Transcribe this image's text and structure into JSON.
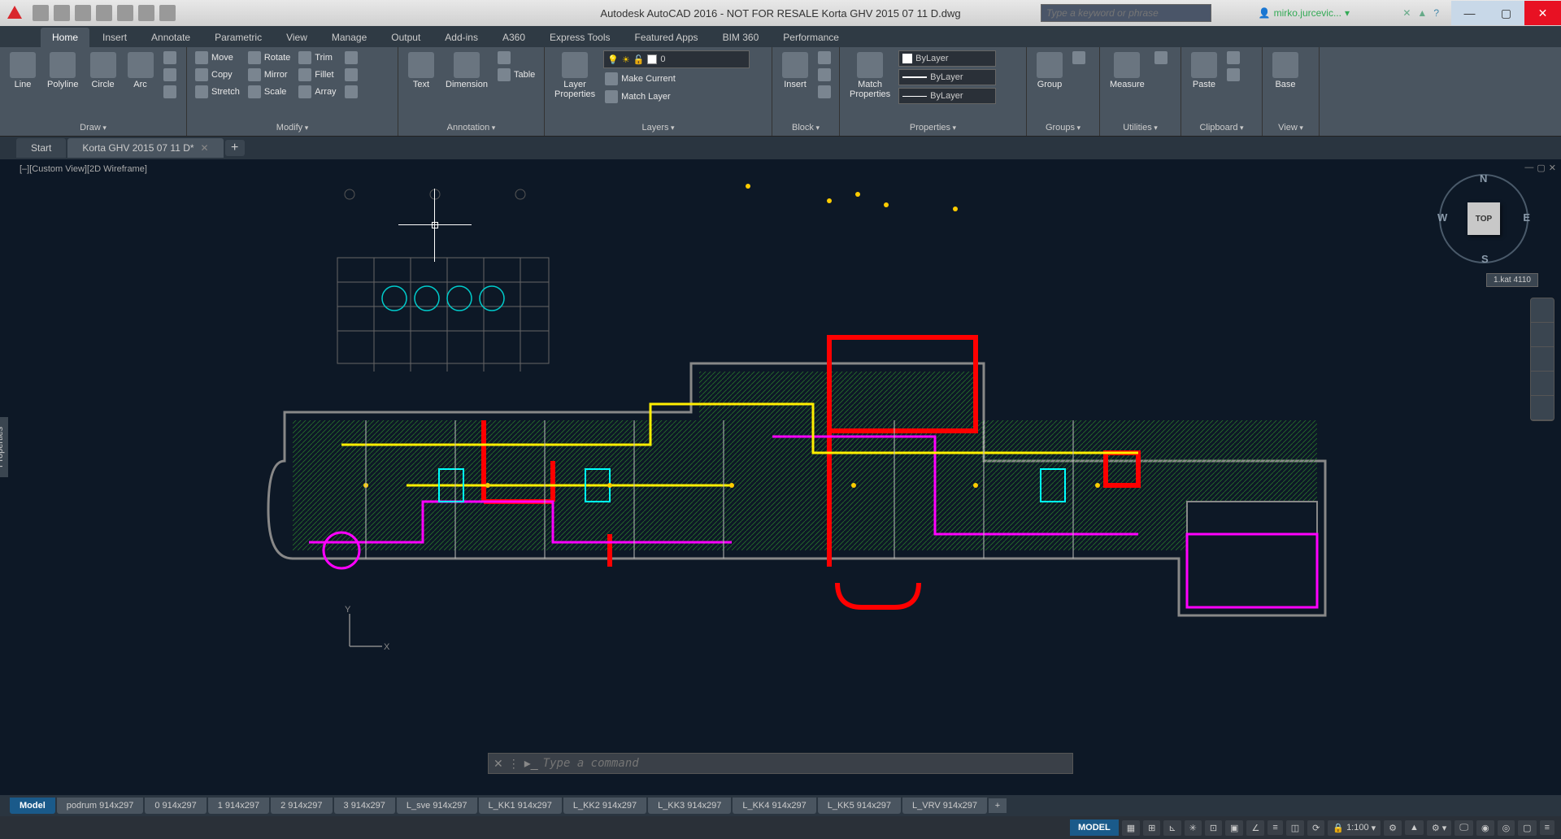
{
  "app": {
    "title": "Autodesk AutoCAD 2016 - NOT FOR RESALE   Korta GHV 2015 07 11 D.dwg",
    "search_placeholder": "Type a keyword or phrase",
    "user": "mirko.jurcevic..."
  },
  "ribbon_tabs": [
    "Home",
    "Insert",
    "Annotate",
    "Parametric",
    "View",
    "Manage",
    "Output",
    "Add-ins",
    "A360",
    "Express Tools",
    "Featured Apps",
    "BIM 360",
    "Performance"
  ],
  "active_ribbon_tab": "Home",
  "panels": {
    "draw": {
      "title": "Draw",
      "items": [
        "Line",
        "Polyline",
        "Circle",
        "Arc"
      ]
    },
    "modify": {
      "title": "Modify",
      "rows": [
        [
          "Move",
          "Rotate",
          "Trim"
        ],
        [
          "Copy",
          "Mirror",
          "Fillet"
        ],
        [
          "Stretch",
          "Scale",
          "Array"
        ]
      ]
    },
    "annotation": {
      "title": "Annotation",
      "items": [
        "Text",
        "Dimension",
        "Table"
      ]
    },
    "layers": {
      "title": "Layers",
      "big": "Layer\nProperties",
      "combo": "0",
      "rows": [
        "Make Current",
        "Match Layer"
      ]
    },
    "block": {
      "title": "Block",
      "items": [
        "Insert"
      ]
    },
    "properties": {
      "title": "Properties",
      "big": "Match\nProperties",
      "combos": [
        "ByLayer",
        "ByLayer",
        "ByLayer"
      ]
    },
    "groups": {
      "title": "Groups",
      "items": [
        "Group"
      ]
    },
    "utilities": {
      "title": "Utilities",
      "items": [
        "Measure"
      ]
    },
    "clipboard": {
      "title": "Clipboard",
      "items": [
        "Paste"
      ]
    },
    "view": {
      "title": "View",
      "items": [
        "Base"
      ]
    }
  },
  "file_tabs": [
    {
      "label": "Start",
      "active": false
    },
    {
      "label": "Korta GHV 2015 07 11 D*",
      "active": true
    }
  ],
  "view_label": "[–][Custom View][2D Wireframe]",
  "viewcube": {
    "face": "TOP",
    "n": "N",
    "s": "S",
    "e": "E",
    "w": "W",
    "coord": "1.kat 4110"
  },
  "properties_panel": "Properties",
  "command_placeholder": "Type a command",
  "layout_tabs": [
    "Model",
    "podrum 914x297",
    "0 914x297",
    "1 914x297",
    "2 914x297",
    "3 914x297",
    "L_sve 914x297",
    "L_KK1 914x297",
    "L_KK2 914x297",
    "L_KK3 914x297",
    "L_KK4 914x297",
    "L_KK5 914x297",
    "L_VRV 914x297"
  ],
  "active_layout": "Model",
  "status": {
    "model": "MODEL",
    "scale": "1:100"
  },
  "ucs": {
    "x": "X",
    "y": "Y"
  }
}
